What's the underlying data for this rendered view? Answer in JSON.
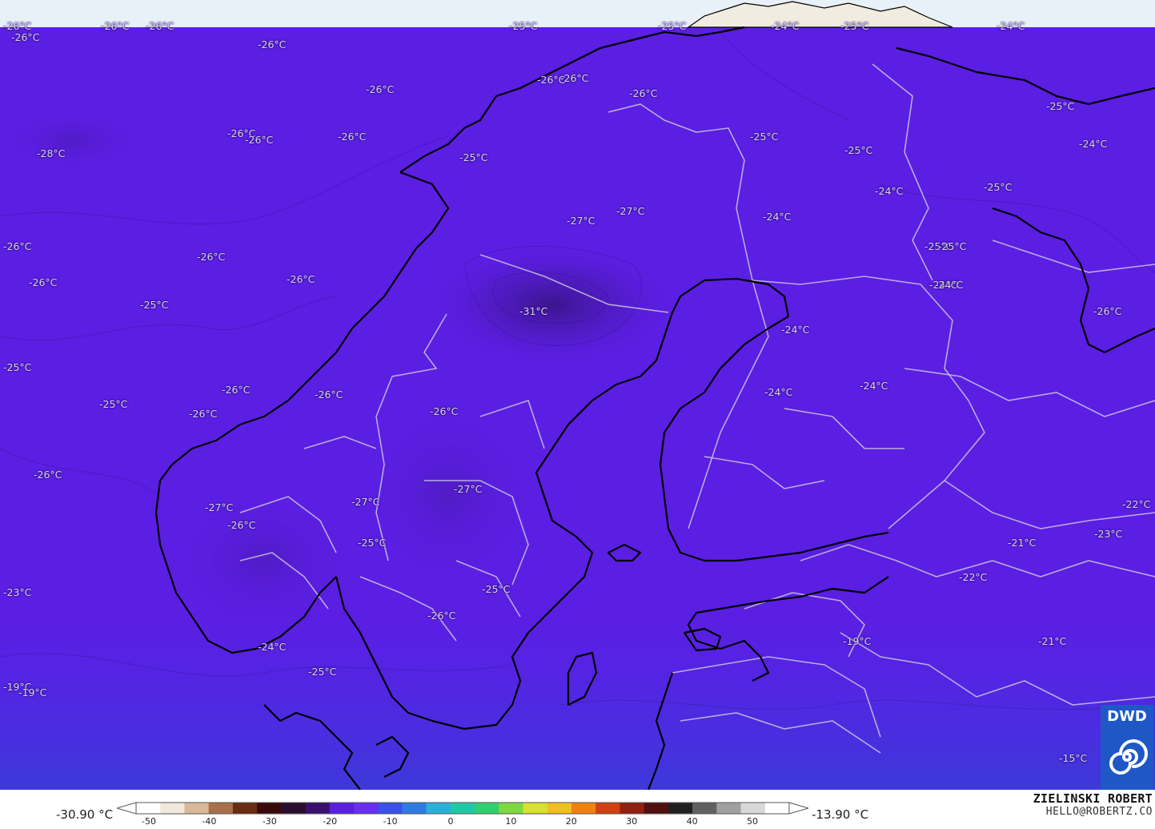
{
  "map": {
    "colors": {
      "field": "#5b1ee3",
      "cold_core": "#3f1790",
      "warm_south": "#3d2bd6",
      "top_band": "#e8f0f8",
      "coast": "#000000",
      "border": "#c8c8d8"
    },
    "temperature_labels": [
      "-26°C",
      "-26°C",
      "-26°C",
      "-26°C",
      "-25°C",
      "-25°C",
      "-24°C",
      "-25°C",
      "-24°C",
      "-26°C",
      "-26°C",
      "-26°C",
      "-28°C",
      "-26°C",
      "-26°C",
      "-26°C",
      "-25°C",
      "-25°C",
      "-25°C",
      "-25°C",
      "-24°C",
      "-27°C",
      "-27°C",
      "-24°C",
      "-24°C",
      "-25°C",
      "-25°C",
      "-26°C",
      "-26°C",
      "-26°C",
      "-25°C",
      "-26°C",
      "-31°C",
      "-24°C",
      "-24°C",
      "-26°C",
      "-25°C",
      "-24°C",
      "-24°C",
      "-26°C",
      "-26°C",
      "-26°C",
      "-25°C",
      "-26°C",
      "-26°C",
      "-27°C",
      "-27°C",
      "-22°C",
      "-26°C",
      "-27°C",
      "-23°C",
      "-25°C",
      "-21°C",
      "-22°C",
      "-23°C",
      "-25°C",
      "-26°C",
      "-19°C",
      "-21°C",
      "-24°C",
      "-25°C",
      "-19°C",
      "-19°C",
      "-15°C",
      "-26°C",
      "-24°C",
      "-25°C",
      "-26°C"
    ]
  },
  "legend": {
    "min_label": "-30.90 °C",
    "max_label": "-13.90 °C",
    "ticks": [
      "-50",
      "-40",
      "-30",
      "-20",
      "-10",
      "0",
      "10",
      "20",
      "30",
      "40",
      "50"
    ],
    "colorbar_colors": [
      "#ffffff",
      "#f2e8dc",
      "#d9b99a",
      "#a8704a",
      "#6b2a12",
      "#3a0a0a",
      "#2b0d2e",
      "#3a0f6e",
      "#5a1ee0",
      "#6a2ef0",
      "#3a50e8",
      "#2f7ae0",
      "#2ab0d8",
      "#20c8a8",
      "#30d070",
      "#80d840",
      "#d8e030",
      "#f0c020",
      "#f08010",
      "#d04010",
      "#902010",
      "#501010",
      "#202020",
      "#606060",
      "#a0a0a0",
      "#d8d8d8",
      "#ffffff"
    ]
  },
  "branding": {
    "author_name": "ZIELINSKI ROBERT",
    "author_email": "HELLO@ROBERTZ.CO",
    "logo_text": "DWD"
  }
}
